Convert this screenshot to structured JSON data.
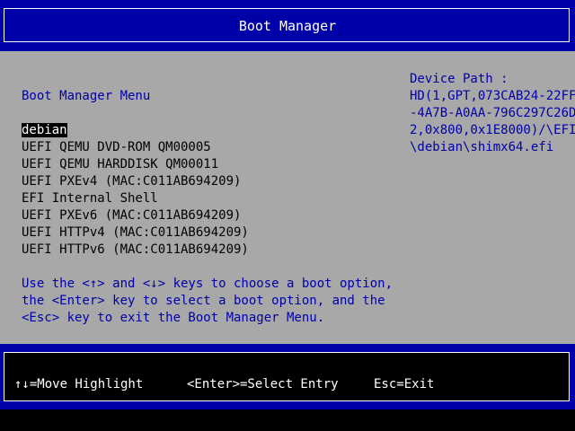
{
  "header": {
    "title": "Boot Manager"
  },
  "menu": {
    "title": "Boot Manager Menu",
    "items": [
      {
        "label": "debian",
        "selected": true
      },
      {
        "label": "UEFI QEMU DVD-ROM QM00005"
      },
      {
        "label": "UEFI QEMU HARDDISK QM00011"
      },
      {
        "label": "UEFI PXEv4 (MAC:C011AB694209)"
      },
      {
        "label": "EFI Internal Shell"
      },
      {
        "label": "UEFI PXEv6 (MAC:C011AB694209)"
      },
      {
        "label": "UEFI HTTPv4 (MAC:C011AB694209)"
      },
      {
        "label": "UEFI HTTPv6 (MAC:C011AB694209)"
      }
    ]
  },
  "help": {
    "lines": [
      "Use the <↑> and <↓> keys to choose a boot option,",
      "the <Enter> key to select a boot option, and the",
      "<Esc> key to exit the Boot Manager Menu."
    ]
  },
  "device_path": {
    "label": "Device Path :",
    "lines": [
      "HD(1,GPT,073CAB24-22FF",
      "-4A7B-A0AA-796C297C26D",
      "2,0x800,0x1E8000)/\\EFI",
      "\\debian\\shimx64.efi"
    ]
  },
  "footer": {
    "move": "↑↓=Move Highlight",
    "select": "<Enter>=Select Entry",
    "exit": "Esc=Exit"
  },
  "colors": {
    "background_blue": "#0000a8",
    "panel_gray": "#a8a8a8",
    "highlight_bg": "#000000",
    "text_white": "#ffffff"
  }
}
